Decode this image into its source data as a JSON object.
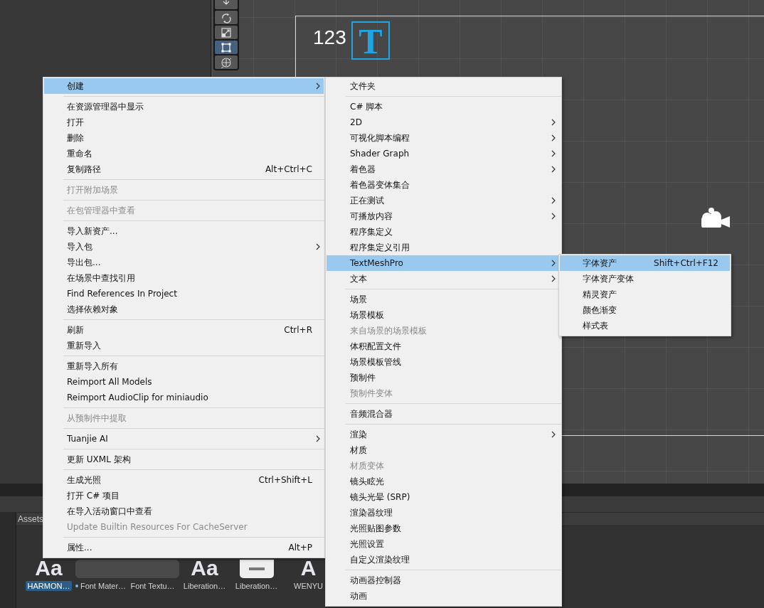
{
  "scene_view": {
    "tools": [
      {
        "kind": "move",
        "selected": false
      },
      {
        "kind": "rotate",
        "selected": false
      },
      {
        "kind": "scale",
        "selected": false
      },
      {
        "kind": "rect",
        "selected": true
      },
      {
        "kind": "transform",
        "selected": false
      }
    ],
    "canvas_label": "123",
    "text_icon_letter": "T"
  },
  "project_panel": {
    "tab": "Assets",
    "assets": [
      {
        "kind": "font",
        "thumb_text": "Aa",
        "label": "HARMON…",
        "selected": true,
        "sub_asset": false
      },
      {
        "kind": "material",
        "label": "Font Mater…",
        "selected": false,
        "sub_asset": true
      },
      {
        "kind": "texture",
        "label": "Font Textu…",
        "selected": false,
        "sub_asset": false
      },
      {
        "kind": "font",
        "thumb_text": "Aa",
        "label": "Liberation…",
        "selected": false,
        "sub_asset": false
      },
      {
        "kind": "document",
        "label": "Liberation…",
        "selected": false,
        "sub_asset": false
      },
      {
        "kind": "font",
        "thumb_text": "A",
        "label": "WENYU",
        "selected": false,
        "sub_asset": false
      }
    ]
  },
  "menus": [
    {
      "items": [
        {
          "kind": "item",
          "label": "创建",
          "submenu": true,
          "selected": true,
          "disabled": false
        },
        {
          "kind": "separator"
        },
        {
          "kind": "item",
          "label": "在资源管理器中显示",
          "submenu": false,
          "selected": false,
          "disabled": false
        },
        {
          "kind": "item",
          "label": "打开",
          "submenu": false,
          "selected": false,
          "disabled": false
        },
        {
          "kind": "item",
          "label": "删除",
          "submenu": false,
          "selected": false,
          "disabled": false
        },
        {
          "kind": "item",
          "label": "重命名",
          "submenu": false,
          "selected": false,
          "disabled": false
        },
        {
          "kind": "item",
          "label": "复制路径",
          "shortcut": "Alt+Ctrl+C",
          "submenu": false,
          "selected": false,
          "disabled": false
        },
        {
          "kind": "separator"
        },
        {
          "kind": "item",
          "label": "打开附加场景",
          "submenu": false,
          "selected": false,
          "disabled": true
        },
        {
          "kind": "separator"
        },
        {
          "kind": "item",
          "label": "在包管理器中查看",
          "submenu": false,
          "selected": false,
          "disabled": true
        },
        {
          "kind": "separator"
        },
        {
          "kind": "item",
          "label": "导入新资产...",
          "submenu": false,
          "selected": false,
          "disabled": false
        },
        {
          "kind": "item",
          "label": "导入包",
          "submenu": true,
          "selected": false,
          "disabled": false
        },
        {
          "kind": "item",
          "label": "导出包...",
          "submenu": false,
          "selected": false,
          "disabled": false
        },
        {
          "kind": "item",
          "label": "在场景中查找引用",
          "submenu": false,
          "selected": false,
          "disabled": false
        },
        {
          "kind": "item",
          "label": "Find References In Project",
          "submenu": false,
          "selected": false,
          "disabled": false
        },
        {
          "kind": "item",
          "label": "选择依赖对象",
          "submenu": false,
          "selected": false,
          "disabled": false
        },
        {
          "kind": "separator"
        },
        {
          "kind": "item",
          "label": "刷新",
          "shortcut": "Ctrl+R",
          "submenu": false,
          "selected": false,
          "disabled": false
        },
        {
          "kind": "item",
          "label": "重新导入",
          "submenu": false,
          "selected": false,
          "disabled": false
        },
        {
          "kind": "separator"
        },
        {
          "kind": "item",
          "label": "重新导入所有",
          "submenu": false,
          "selected": false,
          "disabled": false
        },
        {
          "kind": "item",
          "label": "Reimport All Models",
          "submenu": false,
          "selected": false,
          "disabled": false
        },
        {
          "kind": "item",
          "label": "Reimport AudioClip for miniaudio",
          "submenu": false,
          "selected": false,
          "disabled": false
        },
        {
          "kind": "separator"
        },
        {
          "kind": "item",
          "label": "从预制件中提取",
          "submenu": false,
          "selected": false,
          "disabled": true
        },
        {
          "kind": "separator"
        },
        {
          "kind": "item",
          "label": "Tuanjie AI",
          "submenu": true,
          "selected": false,
          "disabled": false
        },
        {
          "kind": "separator"
        },
        {
          "kind": "item",
          "label": "更新 UXML 架构",
          "submenu": false,
          "selected": false,
          "disabled": false
        },
        {
          "kind": "separator"
        },
        {
          "kind": "item",
          "label": "生成光照",
          "shortcut": "Ctrl+Shift+L",
          "submenu": false,
          "selected": false,
          "disabled": false
        },
        {
          "kind": "item",
          "label": "打开 C# 项目",
          "submenu": false,
          "selected": false,
          "disabled": false
        },
        {
          "kind": "item",
          "label": "在导入活动窗口中查看",
          "submenu": false,
          "selected": false,
          "disabled": false
        },
        {
          "kind": "item",
          "label": "Update Builtin Resources For CacheServer",
          "submenu": false,
          "selected": false,
          "disabled": true
        },
        {
          "kind": "separator"
        },
        {
          "kind": "item",
          "label": "属性...",
          "shortcut": "Alt+P",
          "submenu": false,
          "selected": false,
          "disabled": false
        }
      ]
    },
    {
      "items": [
        {
          "kind": "item",
          "label": "文件夹",
          "submenu": false,
          "selected": false,
          "disabled": false
        },
        {
          "kind": "separator"
        },
        {
          "kind": "item",
          "label": "C# 脚本",
          "submenu": false,
          "selected": false,
          "disabled": false
        },
        {
          "kind": "item",
          "label": "2D",
          "submenu": true,
          "selected": false,
          "disabled": false
        },
        {
          "kind": "item",
          "label": "可视化脚本编程",
          "submenu": true,
          "selected": false,
          "disabled": false
        },
        {
          "kind": "item",
          "label": "Shader Graph",
          "submenu": true,
          "selected": false,
          "disabled": false
        },
        {
          "kind": "item",
          "label": "着色器",
          "submenu": true,
          "selected": false,
          "disabled": false
        },
        {
          "kind": "item",
          "label": "着色器变体集合",
          "submenu": false,
          "selected": false,
          "disabled": false
        },
        {
          "kind": "item",
          "label": "正在测试",
          "submenu": true,
          "selected": false,
          "disabled": false
        },
        {
          "kind": "item",
          "label": "可播放内容",
          "submenu": true,
          "selected": false,
          "disabled": false
        },
        {
          "kind": "item",
          "label": "程序集定义",
          "submenu": false,
          "selected": false,
          "disabled": false
        },
        {
          "kind": "item",
          "label": "程序集定义引用",
          "submenu": false,
          "selected": false,
          "disabled": false
        },
        {
          "kind": "item",
          "label": "TextMeshPro",
          "submenu": true,
          "selected": true,
          "disabled": false
        },
        {
          "kind": "item",
          "label": "文本",
          "submenu": true,
          "selected": false,
          "disabled": false
        },
        {
          "kind": "separator"
        },
        {
          "kind": "item",
          "label": "场景",
          "submenu": false,
          "selected": false,
          "disabled": false
        },
        {
          "kind": "item",
          "label": "场景模板",
          "submenu": false,
          "selected": false,
          "disabled": false
        },
        {
          "kind": "item",
          "label": "来自场景的场景模板",
          "submenu": false,
          "selected": false,
          "disabled": true
        },
        {
          "kind": "item",
          "label": "体积配置文件",
          "submenu": false,
          "selected": false,
          "disabled": false
        },
        {
          "kind": "item",
          "label": "场景模板管线",
          "submenu": false,
          "selected": false,
          "disabled": false
        },
        {
          "kind": "item",
          "label": "预制件",
          "submenu": false,
          "selected": false,
          "disabled": false
        },
        {
          "kind": "item",
          "label": "预制件变体",
          "submenu": false,
          "selected": false,
          "disabled": true
        },
        {
          "kind": "separator"
        },
        {
          "kind": "item",
          "label": "音频混合器",
          "submenu": false,
          "selected": false,
          "disabled": false
        },
        {
          "kind": "separator"
        },
        {
          "kind": "item",
          "label": "渲染",
          "submenu": true,
          "selected": false,
          "disabled": false
        },
        {
          "kind": "item",
          "label": "材质",
          "submenu": false,
          "selected": false,
          "disabled": false
        },
        {
          "kind": "item",
          "label": "材质变体",
          "submenu": false,
          "selected": false,
          "disabled": true
        },
        {
          "kind": "item",
          "label": "镜头眩光",
          "submenu": false,
          "selected": false,
          "disabled": false
        },
        {
          "kind": "item",
          "label": "镜头光晕 (SRP)",
          "submenu": false,
          "selected": false,
          "disabled": false
        },
        {
          "kind": "item",
          "label": "渲染器纹理",
          "submenu": false,
          "selected": false,
          "disabled": false
        },
        {
          "kind": "item",
          "label": "光照贴图参数",
          "submenu": false,
          "selected": false,
          "disabled": false
        },
        {
          "kind": "item",
          "label": "光照设置",
          "submenu": false,
          "selected": false,
          "disabled": false
        },
        {
          "kind": "item",
          "label": "自定义渲染纹理",
          "submenu": false,
          "selected": false,
          "disabled": false
        },
        {
          "kind": "separator"
        },
        {
          "kind": "item",
          "label": "动画器控制器",
          "submenu": false,
          "selected": false,
          "disabled": false
        },
        {
          "kind": "item",
          "label": "动画",
          "submenu": false,
          "selected": false,
          "disabled": false
        }
      ]
    },
    {
      "items": [
        {
          "kind": "item",
          "label": "字体资产",
          "shortcut": "Shift+Ctrl+F12",
          "submenu": false,
          "selected": true,
          "disabled": false
        },
        {
          "kind": "item",
          "label": "字体资产变体",
          "submenu": false,
          "selected": false,
          "disabled": false
        },
        {
          "kind": "item",
          "label": "精灵资产",
          "submenu": false,
          "selected": false,
          "disabled": false
        },
        {
          "kind": "item",
          "label": "颜色渐变",
          "submenu": false,
          "selected": false,
          "disabled": false
        },
        {
          "kind": "item",
          "label": "样式表",
          "submenu": false,
          "selected": false,
          "disabled": false
        }
      ]
    }
  ]
}
